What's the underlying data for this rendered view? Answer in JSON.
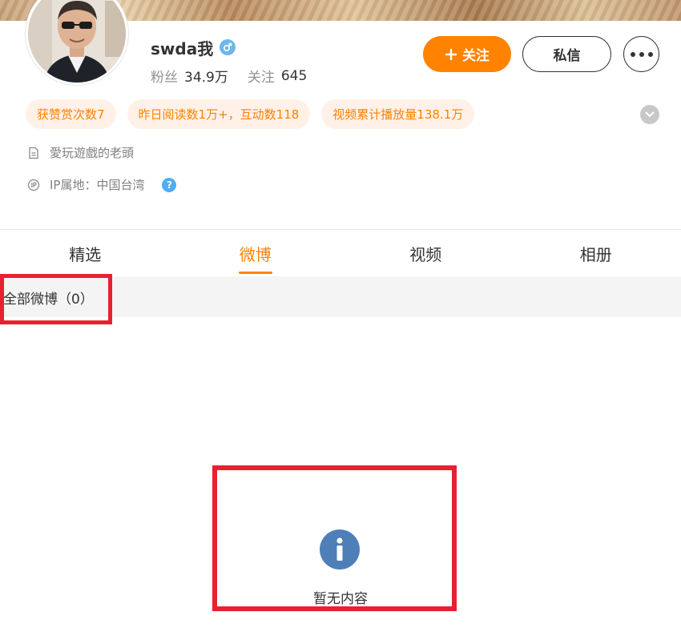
{
  "profile": {
    "name": "swda我",
    "gender_icon": "male-icon",
    "stats": [
      {
        "label": "粉丝",
        "value": "34.9万"
      },
      {
        "label": "关注",
        "value": "645"
      }
    ]
  },
  "actions": {
    "follow_label": "关注",
    "message_label": "私信",
    "more_icon": "more-dots-icon"
  },
  "tags": [
    "获赞赏次数7",
    "昨日阅读数1万+，互动数118",
    "视频累计播放量138.1万"
  ],
  "info": {
    "bio": "愛玩遊戲的老頭",
    "ip": "IP属地：中国台湾"
  },
  "tabs": [
    {
      "label": "精选",
      "active": false
    },
    {
      "label": "微博",
      "active": true
    },
    {
      "label": "视频",
      "active": false
    },
    {
      "label": "相册",
      "active": false
    }
  ],
  "filter": {
    "label": "全部微博（0）"
  },
  "empty": {
    "text": "暂无内容",
    "icon": "info-icon"
  },
  "colors": {
    "accent": "#ff8200",
    "tag_bg": "#fff1e8",
    "highlight_box": "#e8202f",
    "empty_icon": "#4f7fb8",
    "help_icon": "#4eaef5"
  }
}
